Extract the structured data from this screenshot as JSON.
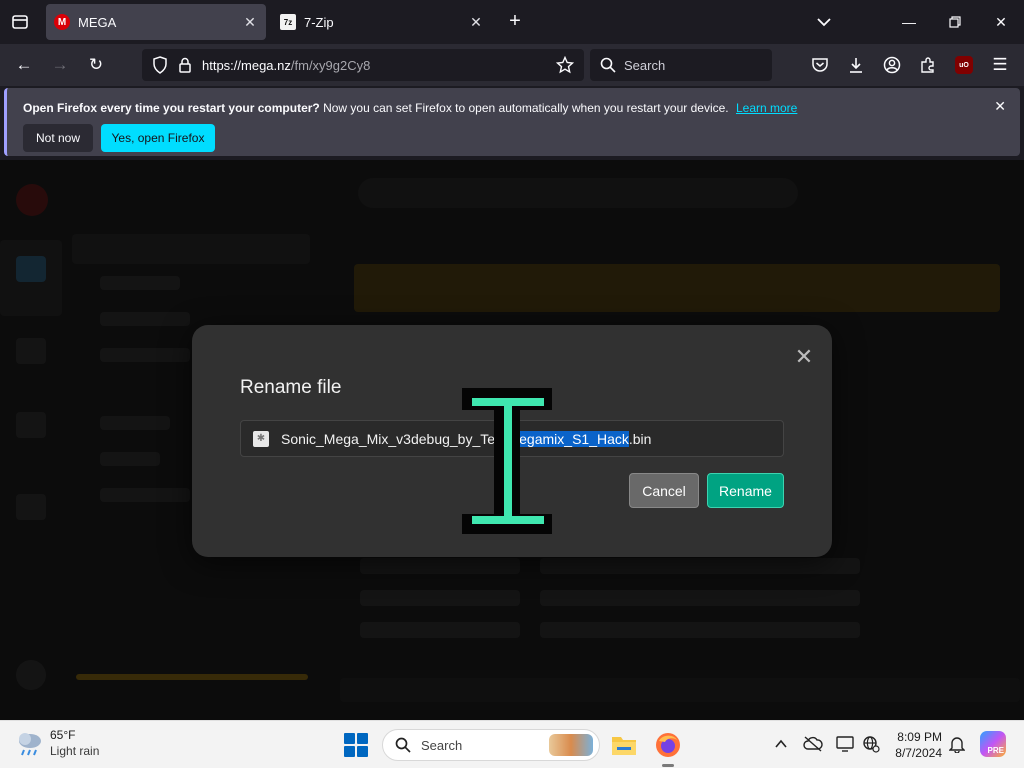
{
  "tabs": [
    {
      "title": "MEGA",
      "favicon_letter": "M",
      "active": true
    },
    {
      "title": "7-Zip",
      "favicon_letter": "7z",
      "active": false
    }
  ],
  "toolbar": {
    "url_host": "https://mega.nz",
    "url_path": "/fm/xy9g2Cy8",
    "search_placeholder": "Search",
    "ublock_label": "uO"
  },
  "notification": {
    "bold_text": "Open Firefox every time you restart your computer?",
    "text": "Now you can set Firefox to open automatically when you restart your device.",
    "link": "Learn more",
    "not_now": "Not now",
    "open_button": "Yes, open Firefox"
  },
  "dialog": {
    "title": "Rename file",
    "filename_before": "Sonic_Mega_Mix_v3debug_by_Tear",
    "filename_selected": "Megamix_S1_Hack",
    "filename_ext": ".bin",
    "cancel": "Cancel",
    "rename": "Rename"
  },
  "taskbar": {
    "temperature": "65°F",
    "condition": "Light rain",
    "search_label": "Search",
    "time": "8:09 PM",
    "date": "8/7/2024",
    "copilot_badge": "PRE"
  },
  "colors": {
    "accent_cyan": "#00ddff",
    "mega_red": "#d90007",
    "rename_green": "#00a382",
    "cursor_green": "#3fe8b0",
    "selection_blue": "#0a63c9"
  }
}
